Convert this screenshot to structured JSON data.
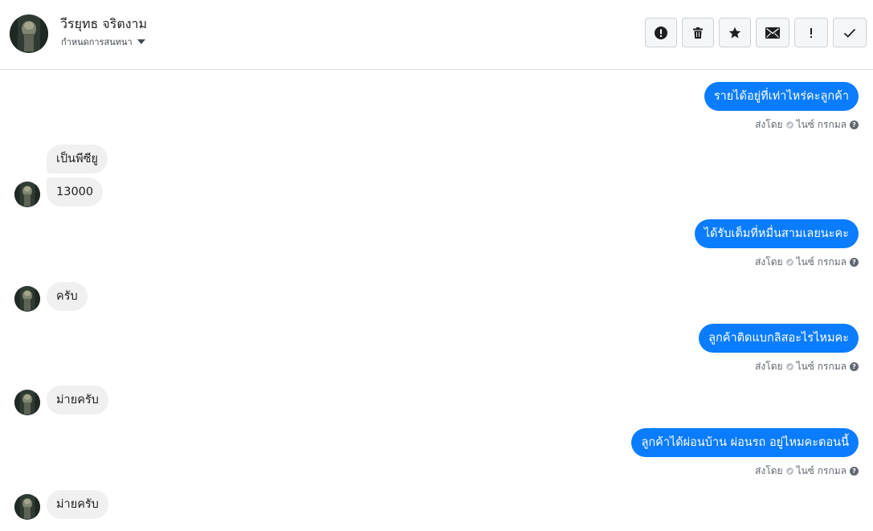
{
  "header": {
    "contact_name": "วีรยุทธ จริตงาม",
    "assign_label": "กำหนดการสนทนา",
    "toolbar": [
      {
        "name": "report-spam-button",
        "icon": "alert-circle-icon"
      },
      {
        "name": "delete-button",
        "icon": "trash-icon"
      },
      {
        "name": "star-button",
        "icon": "star-icon"
      },
      {
        "name": "mark-unread-button",
        "icon": "envelope-icon"
      },
      {
        "name": "follow-up-button",
        "icon": "exclamation-icon"
      },
      {
        "name": "mark-done-button",
        "icon": "checkmark-icon"
      }
    ]
  },
  "messages": [
    {
      "direction": "out",
      "text": "รายได้อยู่ที่เท่าไหร่คะลูกค้า",
      "meta_prefix": "ส่งโดย",
      "meta_sender": "ไนซ์ กรกมล"
    },
    {
      "direction": "in",
      "text": "เป็นพีซียู"
    },
    {
      "direction": "in",
      "text": "13000"
    },
    {
      "direction": "out",
      "text": "ได้รับเต็มที่หมื่นสามเลยนะคะ",
      "meta_prefix": "ส่งโดย",
      "meta_sender": "ไนซ์ กรกมล"
    },
    {
      "direction": "in",
      "text": "ครับ"
    },
    {
      "direction": "out",
      "text": "ลูกค้าติดแบกลิสอะไรไหมคะ",
      "meta_prefix": "ส่งโดย",
      "meta_sender": "ไนซ์ กรกมล"
    },
    {
      "direction": "in",
      "text": "ม่ายครับ"
    },
    {
      "direction": "out",
      "text": "ลูกค้าได้ผ่อนบ้าน ผ่อนรถ  อยู่ไหมคะตอนนี้",
      "meta_prefix": "ส่งโดย",
      "meta_sender": "ไนซ์ กรกมล"
    },
    {
      "direction": "in",
      "text": "ม่ายครับ"
    }
  ],
  "colors": {
    "outgoing_bubble": "#0a7cff",
    "incoming_bubble": "#f0f0f0",
    "divider": "#dadde1"
  }
}
